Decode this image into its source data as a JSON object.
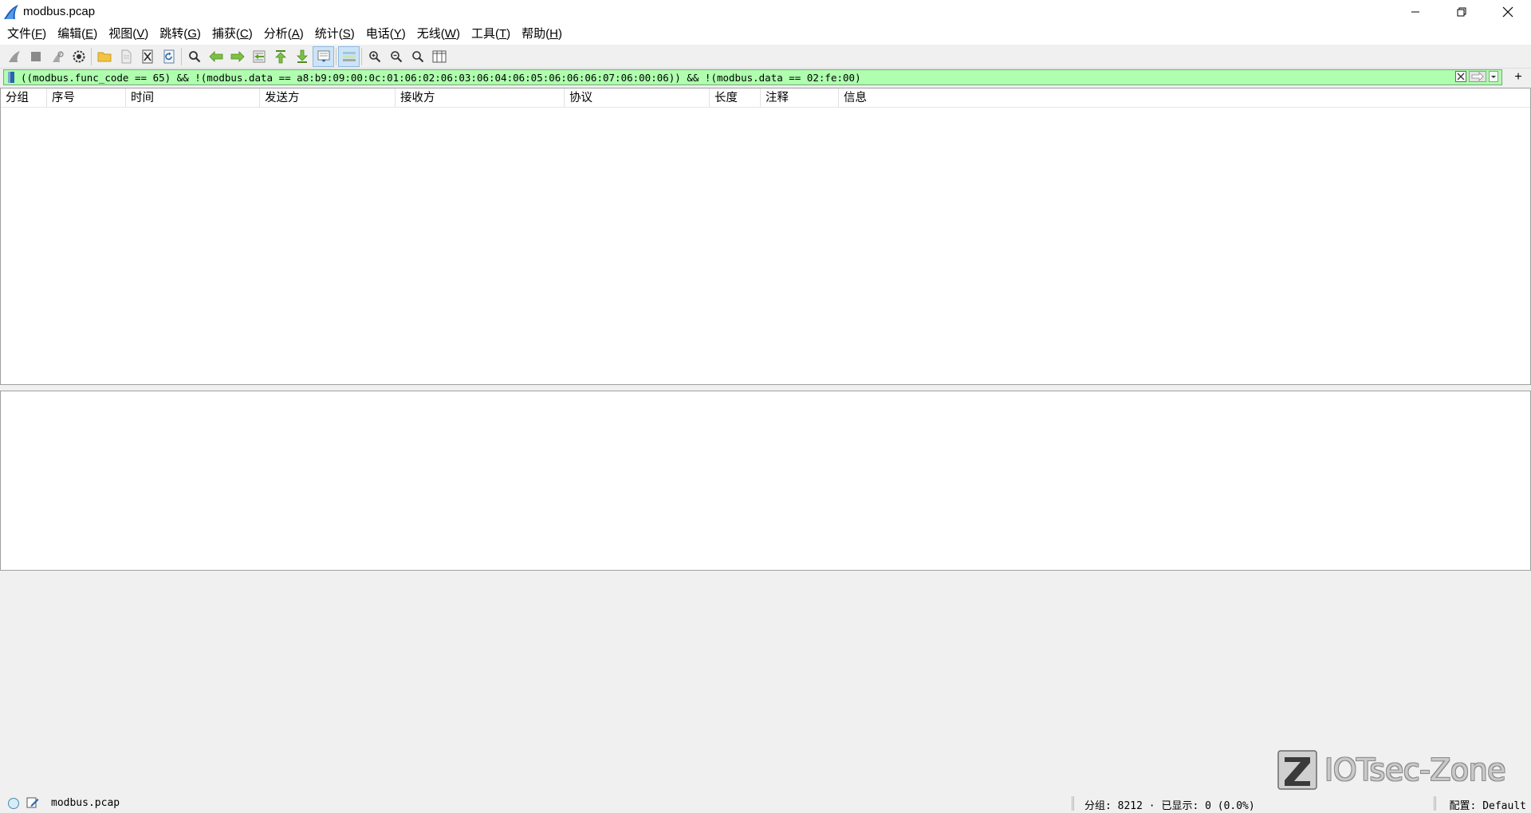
{
  "window": {
    "title": "modbus.pcap"
  },
  "menu": [
    {
      "label": "文件(",
      "mnemonic": "F",
      "suffix": ")"
    },
    {
      "label": "编辑(",
      "mnemonic": "E",
      "suffix": ")"
    },
    {
      "label": "视图(",
      "mnemonic": "V",
      "suffix": ")"
    },
    {
      "label": "跳转(",
      "mnemonic": "G",
      "suffix": ")"
    },
    {
      "label": "捕获(",
      "mnemonic": "C",
      "suffix": ")"
    },
    {
      "label": "分析(",
      "mnemonic": "A",
      "suffix": ")"
    },
    {
      "label": "统计(",
      "mnemonic": "S",
      "suffix": ")"
    },
    {
      "label": "电话(",
      "mnemonic": "Y",
      "suffix": ")"
    },
    {
      "label": "无线(",
      "mnemonic": "W",
      "suffix": ")"
    },
    {
      "label": "工具(",
      "mnemonic": "T",
      "suffix": ")"
    },
    {
      "label": "帮助(",
      "mnemonic": "H",
      "suffix": ")"
    }
  ],
  "filter": {
    "text": "((modbus.func_code == 65) && !(modbus.data == a8:b9:09:00:0c:01:06:02:06:03:06:04:06:05:06:06:06:07:06:00:06)) && !(modbus.data == 02:fe:00)",
    "color": "#afffaf",
    "plus": "+"
  },
  "packet_list": {
    "columns": [
      "分组",
      "序号",
      "时间",
      "发送方",
      "接收方",
      "协议",
      "长度",
      "注释",
      "信息"
    ]
  },
  "watermark": {
    "text": "IOTsec-Zone"
  },
  "status": {
    "file": "modbus.pcap",
    "packets": "分组: 8212 · 已显示: 0 (0.0%)",
    "profile": "配置: Default"
  }
}
